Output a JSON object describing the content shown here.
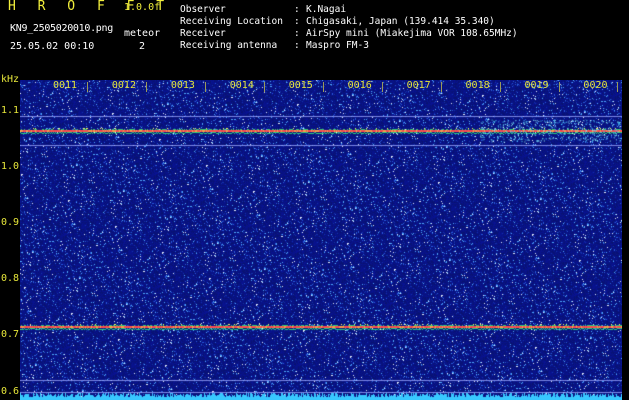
{
  "header": {
    "app_title": "H R O F F T",
    "version": "1.0.0f",
    "filename": "KN9_2505020010.png",
    "timestamp": "25.05.02 00:10",
    "meteor_label": "meteor",
    "meteor_count": "2"
  },
  "info": [
    {
      "key": "Observer",
      "sep": ":",
      "value": "K.Nagai"
    },
    {
      "key": "Receiving Location",
      "sep": ":",
      "value": "Chigasaki, Japan (139.414 35.340)"
    },
    {
      "key": "Receiver",
      "sep": ":",
      "value": "AirSpy mini (Miakejima VOR 108.65MHz)"
    },
    {
      "key": "Receiving antenna",
      "sep": ":",
      "value": "Maspro FM-3"
    }
  ],
  "spectrogram": {
    "y_unit": "kHz",
    "y_ticks": [
      "1.1",
      "1.0",
      "0.9",
      "0.8",
      "0.7",
      "0.6"
    ],
    "y_range": [
      0.585,
      1.155
    ],
    "x_ticks": [
      "0011",
      "0012",
      "0013",
      "0014",
      "0015",
      "0016",
      "0017",
      "0018",
      "0019",
      "0020"
    ],
    "signal_lines_khz": [
      1.065,
      0.715
    ],
    "reference_lines_khz": [
      1.09,
      1.04,
      0.62,
      0.6
    ],
    "colors": {
      "background": "#0d1780",
      "label": "#e6e63a",
      "signal_core": "#ff4d4d",
      "signal_edge": "#28d07a",
      "reference": "#9aa6ff",
      "noise_floor": "#38c8ff"
    }
  }
}
